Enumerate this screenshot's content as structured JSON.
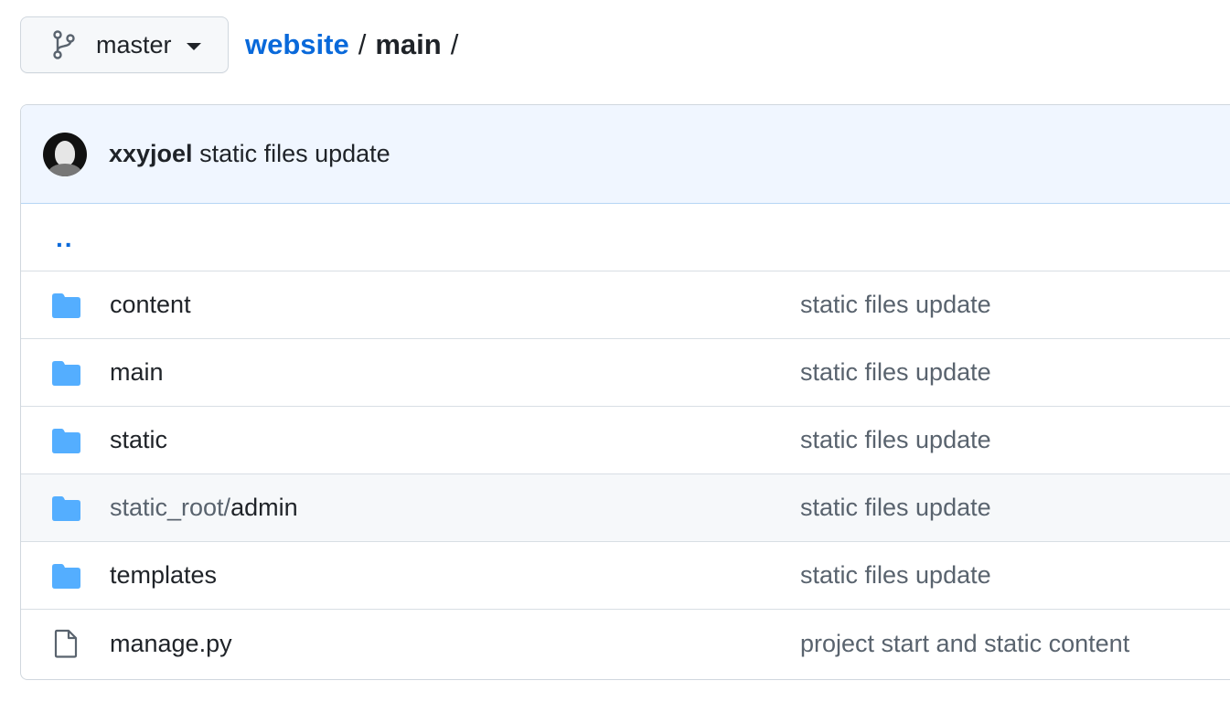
{
  "branch": {
    "name": "master"
  },
  "breadcrumb": {
    "repo": "website",
    "separator": "/",
    "current": "main",
    "trail": "/"
  },
  "commit": {
    "author": "xxyjoel",
    "message": "static files update"
  },
  "parent_link": "..",
  "files": [
    {
      "type": "folder",
      "prefix": "",
      "name": "content",
      "message": "static files update"
    },
    {
      "type": "folder",
      "prefix": "",
      "name": "main",
      "message": "static files update"
    },
    {
      "type": "folder",
      "prefix": "",
      "name": "static",
      "message": "static files update"
    },
    {
      "type": "folder",
      "prefix": "static_root/",
      "name": "admin",
      "message": "static files update"
    },
    {
      "type": "folder",
      "prefix": "",
      "name": "templates",
      "message": "static files update"
    },
    {
      "type": "file",
      "prefix": "",
      "name": "manage.py",
      "message": "project start and static content"
    }
  ],
  "colors": {
    "link": "#0969da",
    "folder": "#54aeff",
    "header_bg": "#f0f6ff"
  }
}
